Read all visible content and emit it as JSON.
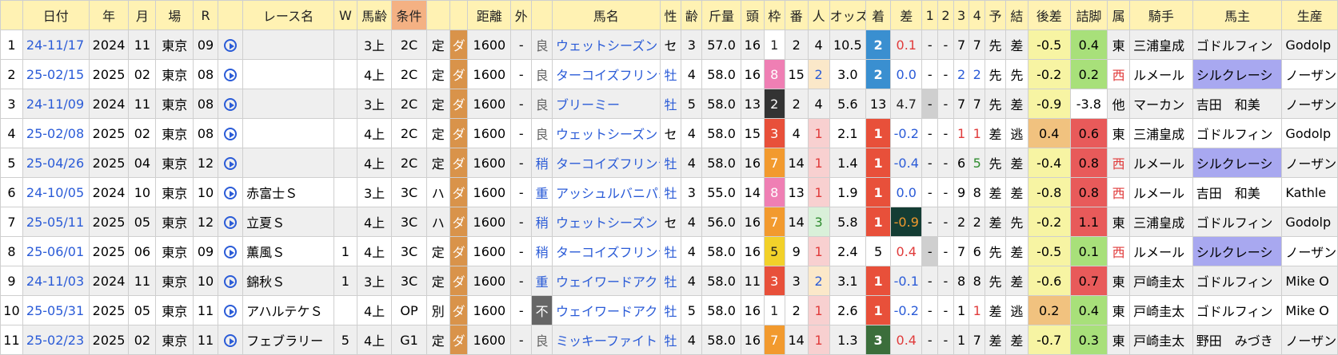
{
  "headers": [
    "",
    "日付",
    "年",
    "月",
    "場",
    "R",
    "",
    "レース名",
    "W",
    "馬齢",
    "条件",
    "",
    "",
    "距離",
    "外",
    "",
    "馬名",
    "性",
    "齢",
    "斤量",
    "頭",
    "枠",
    "番",
    "人",
    "オッズ",
    "着",
    "差",
    "1",
    "2",
    "3",
    "4",
    "予",
    "結",
    "後差",
    "詰脚",
    "属",
    "騎手",
    "馬主",
    "生産"
  ],
  "rows": [
    {
      "no": "1",
      "date": "24-11/17",
      "year": "2024",
      "month": "11",
      "place": "東京",
      "r": "09",
      "race": "",
      "w": "",
      "age": "3上",
      "cond": "2C",
      "type": "定",
      "surf": "ダ",
      "dist": "1600",
      "out": "-",
      "track": "良",
      "horse": "ウェットシーズン",
      "sex": "セ",
      "hage": "3",
      "kin": "57.0",
      "head": "16",
      "waku": "1",
      "ban": "2",
      "pop": "4",
      "odds": "10.5",
      "chaku": "2",
      "sa": "0.1",
      "c1": "-",
      "c2": "-",
      "c3": "7",
      "c4": "7",
      "yo": "先",
      "ke": "差",
      "kosa": "-0.5",
      "tsume": "0.4",
      "zoku": "東",
      "jockey": "三浦皇成",
      "owner": "ゴドルフィン",
      "prod": "Godolp"
    },
    {
      "no": "2",
      "date": "25-02/15",
      "year": "2025",
      "month": "02",
      "place": "東京",
      "r": "08",
      "race": "",
      "w": "",
      "age": "4上",
      "cond": "2C",
      "type": "定",
      "surf": "ダ",
      "dist": "1600",
      "out": "-",
      "track": "良",
      "horse": "ターコイズフリンジ",
      "sex": "牡",
      "hage": "4",
      "kin": "58.0",
      "head": "16",
      "waku": "8",
      "ban": "15",
      "pop": "2",
      "odds": "3.0",
      "chaku": "2",
      "sa": "0.0",
      "c1": "-",
      "c2": "-",
      "c3": "2",
      "c4": "2",
      "yo": "先",
      "ke": "先",
      "kosa": "-0.2",
      "tsume": "0.2",
      "zoku": "西",
      "jockey": "ルメール",
      "owner": "シルクレーシ",
      "prod": "ノーザンF"
    },
    {
      "no": "3",
      "date": "24-11/09",
      "year": "2024",
      "month": "11",
      "place": "東京",
      "r": "08",
      "race": "",
      "w": "",
      "age": "3上",
      "cond": "2C",
      "type": "定",
      "surf": "ダ",
      "dist": "1600",
      "out": "-",
      "track": "良",
      "horse": "ブリーミー",
      "sex": "牡",
      "hage": "5",
      "kin": "58.0",
      "head": "13",
      "waku": "2",
      "ban": "2",
      "pop": "4",
      "odds": "5.6",
      "chaku": "13",
      "sa": "4.7",
      "c1": "-",
      "c2": "-",
      "c3": "7",
      "c4": "7",
      "yo": "先",
      "ke": "差",
      "kosa": "-0.9",
      "tsume": "-3.8",
      "zoku": "他",
      "jockey": "マーカン",
      "owner": "吉田　和美",
      "prod": "ノーザンF"
    },
    {
      "no": "4",
      "date": "25-02/08",
      "year": "2025",
      "month": "02",
      "place": "東京",
      "r": "08",
      "race": "",
      "w": "",
      "age": "4上",
      "cond": "2C",
      "type": "定",
      "surf": "ダ",
      "dist": "1600",
      "out": "-",
      "track": "良",
      "horse": "ウェットシーズン",
      "sex": "セ",
      "hage": "4",
      "kin": "58.0",
      "head": "15",
      "waku": "3",
      "ban": "4",
      "pop": "1",
      "odds": "2.1",
      "chaku": "1",
      "sa": "-0.2",
      "c1": "-",
      "c2": "-",
      "c3": "1",
      "c4": "1",
      "yo": "差",
      "ke": "逃",
      "kosa": "0.4",
      "tsume": "0.6",
      "zoku": "東",
      "jockey": "三浦皇成",
      "owner": "ゴドルフィン",
      "prod": "Godolp"
    },
    {
      "no": "5",
      "date": "25-04/26",
      "year": "2025",
      "month": "04",
      "place": "東京",
      "r": "12",
      "race": "",
      "w": "",
      "age": "4上",
      "cond": "2C",
      "type": "定",
      "surf": "ダ",
      "dist": "1600",
      "out": "-",
      "track": "稍",
      "horse": "ターコイズフリンジ",
      "sex": "牡",
      "hage": "4",
      "kin": "58.0",
      "head": "16",
      "waku": "7",
      "ban": "14",
      "pop": "1",
      "odds": "1.4",
      "chaku": "1",
      "sa": "-0.4",
      "c1": "-",
      "c2": "-",
      "c3": "6",
      "c4": "5",
      "yo": "先",
      "ke": "差",
      "kosa": "-0.4",
      "tsume": "0.8",
      "zoku": "西",
      "jockey": "ルメール",
      "owner": "シルクレーシ",
      "prod": "ノーザンF"
    },
    {
      "no": "6",
      "date": "24-10/05",
      "year": "2024",
      "month": "10",
      "place": "東京",
      "r": "10",
      "race": "赤富士Ｓ",
      "w": "",
      "age": "3上",
      "cond": "3C",
      "type": "ハ",
      "surf": "ダ",
      "dist": "1600",
      "out": "-",
      "track": "重",
      "horse": "アッシュルバニパル",
      "sex": "牡",
      "hage": "3",
      "kin": "55.0",
      "head": "14",
      "waku": "8",
      "ban": "13",
      "pop": "1",
      "odds": "1.9",
      "chaku": "1",
      "sa": "0.0",
      "c1": "-",
      "c2": "-",
      "c3": "9",
      "c4": "8",
      "yo": "差",
      "ke": "差",
      "kosa": "-0.8",
      "tsume": "0.8",
      "zoku": "西",
      "jockey": "ルメール",
      "owner": "吉田　和美",
      "prod": "Kathle"
    },
    {
      "no": "7",
      "date": "25-05/11",
      "year": "2025",
      "month": "05",
      "place": "東京",
      "r": "12",
      "race": "立夏Ｓ",
      "w": "",
      "age": "4上",
      "cond": "3C",
      "type": "ハ",
      "surf": "ダ",
      "dist": "1600",
      "out": "-",
      "track": "稍",
      "horse": "ウェットシーズン",
      "sex": "セ",
      "hage": "4",
      "kin": "56.0",
      "head": "16",
      "waku": "7",
      "ban": "14",
      "pop": "3",
      "odds": "5.8",
      "chaku": "1",
      "sa": "-0.9",
      "c1": "-",
      "c2": "-",
      "c3": "2",
      "c4": "2",
      "yo": "差",
      "ke": "先",
      "kosa": "-0.2",
      "tsume": "1.1",
      "zoku": "東",
      "jockey": "三浦皇成",
      "owner": "ゴドルフィン",
      "prod": "Godolp"
    },
    {
      "no": "8",
      "date": "25-06/01",
      "year": "2025",
      "month": "06",
      "place": "東京",
      "r": "09",
      "race": "薫風Ｓ",
      "w": "1",
      "age": "4上",
      "cond": "3C",
      "type": "定",
      "surf": "ダ",
      "dist": "1600",
      "out": "-",
      "track": "稍",
      "horse": "ターコイズフリンジ",
      "sex": "牡",
      "hage": "4",
      "kin": "58.0",
      "head": "16",
      "waku": "5",
      "ban": "9",
      "pop": "1",
      "odds": "2.4",
      "chaku": "5",
      "sa": "0.4",
      "c1": "-",
      "c2": "-",
      "c3": "7",
      "c4": "6",
      "yo": "先",
      "ke": "差",
      "kosa": "-0.5",
      "tsume": "0.1",
      "zoku": "西",
      "jockey": "ルメール",
      "owner": "シルクレーシ",
      "prod": "ノーザンF"
    },
    {
      "no": "9",
      "date": "24-11/03",
      "year": "2024",
      "month": "11",
      "place": "東京",
      "r": "10",
      "race": "錦秋Ｓ",
      "w": "1",
      "age": "3上",
      "cond": "3C",
      "type": "定",
      "surf": "ダ",
      "dist": "1600",
      "out": "-",
      "track": "重",
      "horse": "ウェイワードアクト",
      "sex": "牡",
      "hage": "4",
      "kin": "58.0",
      "head": "11",
      "waku": "3",
      "ban": "3",
      "pop": "2",
      "odds": "3.1",
      "chaku": "1",
      "sa": "-0.1",
      "c1": "-",
      "c2": "-",
      "c3": "8",
      "c4": "8",
      "yo": "先",
      "ke": "差",
      "kosa": "-0.6",
      "tsume": "0.7",
      "zoku": "東",
      "jockey": "戸崎圭太",
      "owner": "ゴドルフィン",
      "prod": "Mike O"
    },
    {
      "no": "10",
      "date": "25-05/31",
      "year": "2025",
      "month": "05",
      "place": "東京",
      "r": "11",
      "race": "アハルテケＳ",
      "w": "",
      "age": "4上",
      "cond": "OP",
      "type": "別",
      "surf": "ダ",
      "dist": "1600",
      "out": "-",
      "track": "不",
      "horse": "ウェイワードアクト",
      "sex": "牡",
      "hage": "5",
      "kin": "58.0",
      "head": "16",
      "waku": "1",
      "ban": "2",
      "pop": "1",
      "odds": "2.6",
      "chaku": "1",
      "sa": "-0.2",
      "c1": "-",
      "c2": "-",
      "c3": "1",
      "c4": "1",
      "yo": "差",
      "ke": "逃",
      "kosa": "0.2",
      "tsume": "0.4",
      "zoku": "東",
      "jockey": "戸崎圭太",
      "owner": "ゴドルフィン",
      "prod": "Mike O"
    },
    {
      "no": "11",
      "date": "25-02/23",
      "year": "2025",
      "month": "02",
      "place": "東京",
      "r": "11",
      "race": "フェブラリー",
      "w": "5",
      "age": "4上",
      "cond": "G1",
      "type": "定",
      "surf": "ダ",
      "dist": "1600",
      "out": "-",
      "track": "良",
      "horse": "ミッキーファイト",
      "sex": "牡",
      "hage": "4",
      "kin": "58.0",
      "head": "16",
      "waku": "7",
      "ban": "14",
      "pop": "1",
      "odds": "1.3",
      "chaku": "3",
      "sa": "0.4",
      "c1": "-",
      "c2": "-",
      "c3": "1",
      "c4": "7",
      "yo": "差",
      "ke": "差",
      "kosa": "-0.7",
      "tsume": "0.3",
      "zoku": "東",
      "jockey": "戸崎圭太",
      "owner": "野田　みづき",
      "prod": "ノーザンF"
    }
  ],
  "colors": {
    "waku": {
      "1": "#ffffff",
      "2": "#333333",
      "3": "#e8503a",
      "4": "#3a7fd0",
      "5": "#f2d12a",
      "6": "#4caf50",
      "7": "#f29a2e",
      "8": "#ef7fb4"
    },
    "chaku": {
      "1": "#e8503a",
      "2": "#3a8fd0",
      "3": "#3b6e3b",
      "other": "transparent"
    },
    "sa_pos": "#e03b3b",
    "sa_neg": "#2a5bd7",
    "sa_hi": "#143d34",
    "kosa_pos": "#f1c27f",
    "kosa_neg": "#f7f4a3",
    "tsume_pos": "#e85a5a",
    "tsume_mid": "#a8e07a",
    "tsume_neg": "#ffffff",
    "silk": "#a8a8f0",
    "pop1": "#f8d0d0",
    "pop2": "#fbe8c9",
    "pop3": "#d9f0d9"
  }
}
